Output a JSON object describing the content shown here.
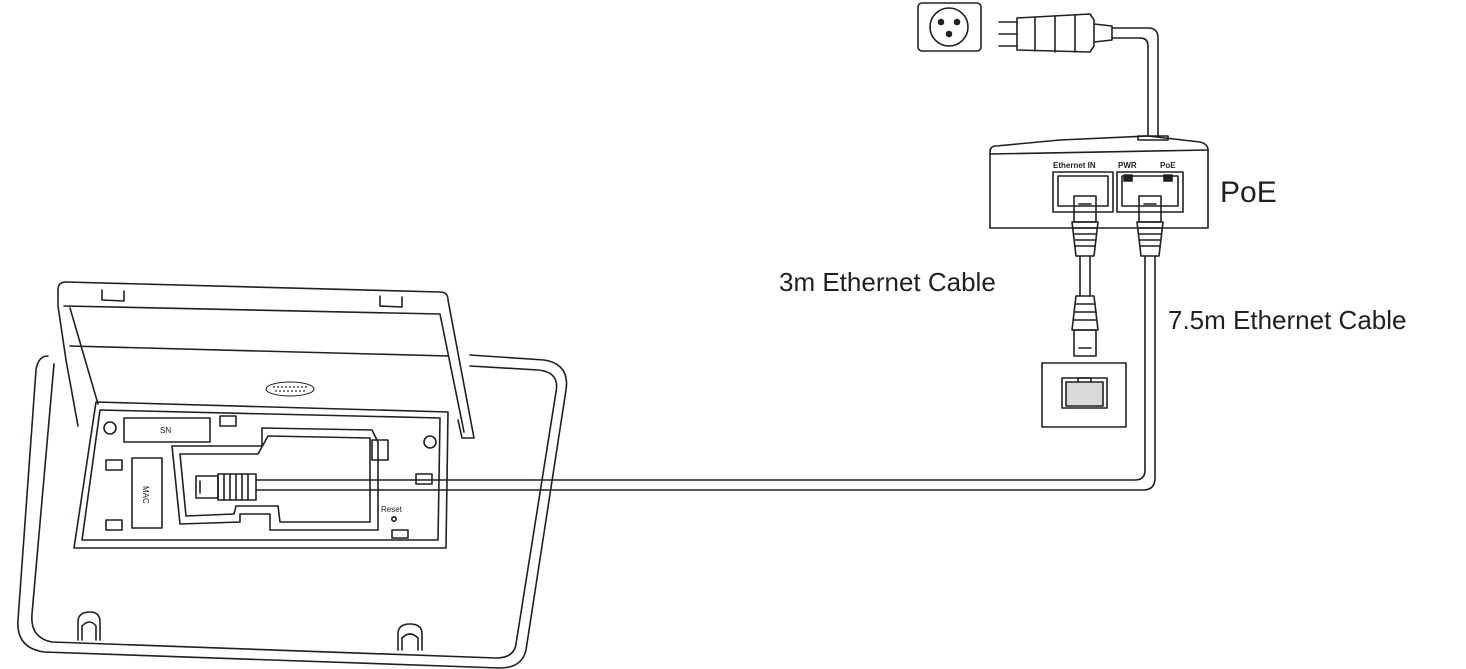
{
  "labels": {
    "poe": "PoE",
    "cable_3m": "3m Ethernet Cable",
    "cable_75m": "7.5m Ethernet Cable"
  },
  "poe_ports": {
    "ethernet_in": "Ethernet IN",
    "pwr": "PWR",
    "poe": "PoE"
  },
  "device_labels": {
    "sn": "SN",
    "mac": "MAC",
    "reset": "Reset"
  },
  "colors": {
    "line": "#231f20",
    "port_fill": "#d9d9d9"
  }
}
